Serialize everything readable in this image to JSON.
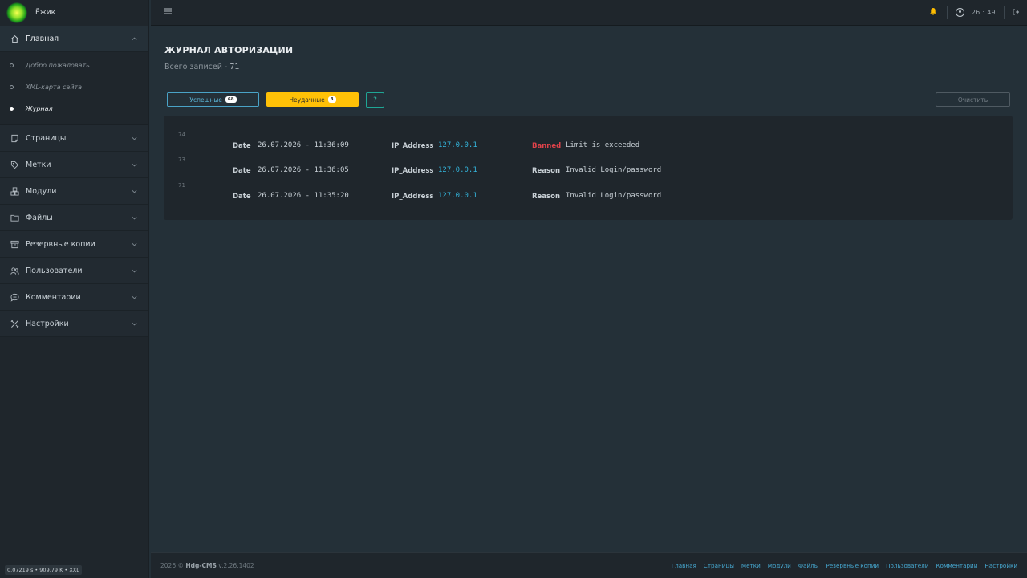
{
  "brand": {
    "name": "Ёжик"
  },
  "sidebar": {
    "home": {
      "label": "Главная",
      "icon": "home-icon"
    },
    "home_sub": [
      {
        "label": "Добро пожаловать",
        "current": false
      },
      {
        "label": "XML-карта сайта",
        "current": false
      },
      {
        "label": "Журнал",
        "current": true
      }
    ],
    "items": [
      {
        "label": "Страницы",
        "icon": "pages-icon"
      },
      {
        "label": "Метки",
        "icon": "tag-icon"
      },
      {
        "label": "Модули",
        "icon": "modules-icon"
      },
      {
        "label": "Файлы",
        "icon": "folder-icon"
      },
      {
        "label": "Резервные копии",
        "icon": "archive-icon"
      },
      {
        "label": "Пользователи",
        "icon": "users-icon"
      },
      {
        "label": "Комментарии",
        "icon": "comments-icon"
      },
      {
        "label": "Настройки",
        "icon": "tools-icon"
      }
    ]
  },
  "debug": {
    "text": "0.07219 s • 909.79 K • XXL"
  },
  "header": {
    "time": "26 : 49"
  },
  "page": {
    "title": "ЖУРНАЛ АВТОРИЗАЦИИ",
    "subtitle_prefix": "Всего записей - ",
    "total": "71"
  },
  "filters": {
    "success_label": "Успешные",
    "success_count": "68",
    "fail_label": "Неудачные",
    "fail_count": "3",
    "help_label": "?",
    "clear_label": "Очистить"
  },
  "log": {
    "date_key": "Date",
    "ip_key": "IP_Address",
    "entries": [
      {
        "num": "74",
        "date": "26.07.2026 - 11:36:09",
        "ip": "127.0.0.1",
        "status_key": "Banned",
        "message": "Limit is exceeded"
      },
      {
        "num": "73",
        "date": "26.07.2026 - 11:36:05",
        "ip": "127.0.0.1",
        "status_key": "Reason",
        "message": "Invalid Login/password"
      },
      {
        "num": "71",
        "date": "26.07.2026 - 11:35:20",
        "ip": "127.0.0.1",
        "status_key": "Reason",
        "message": "Invalid Login/password"
      }
    ]
  },
  "footer": {
    "copyright": "2026 ©",
    "product": "Hdg-CMS",
    "version": "v.2.26.1402",
    "links": [
      "Главная",
      "Страницы",
      "Метки",
      "Модули",
      "Файлы",
      "Резервные копии",
      "Пользователи",
      "Комментарии",
      "Настройки"
    ]
  },
  "colors": {
    "accent": "#ffc107",
    "link": "#33b4db",
    "danger": "#e0424a",
    "success_outline": "#4aa3c7"
  }
}
